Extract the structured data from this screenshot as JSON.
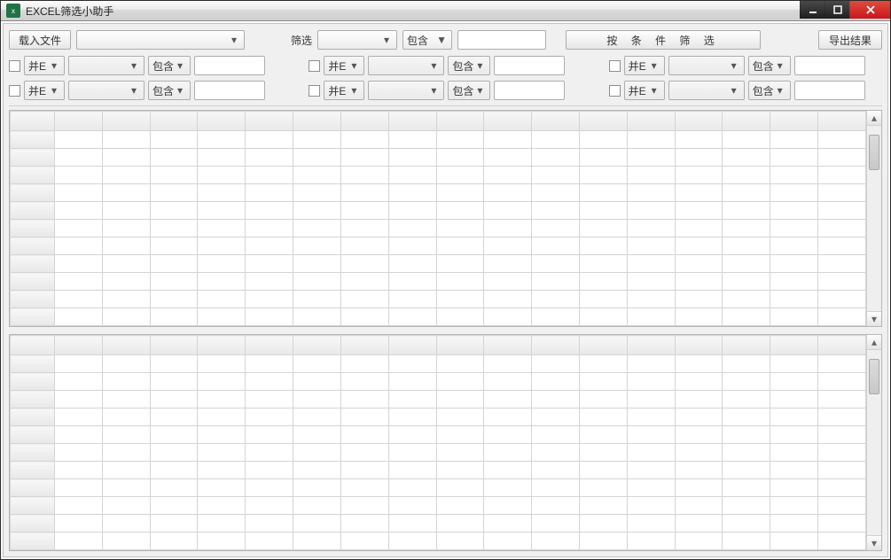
{
  "window": {
    "title": "EXCEL筛选小助手"
  },
  "toolbar": {
    "load_file": "载入文件",
    "filter_label": "筛选",
    "contains": "包含",
    "filter_by_condition": "按 条 件 筛 选",
    "export_result": "导出结果"
  },
  "filter_cell": {
    "and_label": "并E",
    "op_label": "包含"
  },
  "grid": {
    "cols": 17,
    "top_rows": 11,
    "bottom_rows": 11
  }
}
